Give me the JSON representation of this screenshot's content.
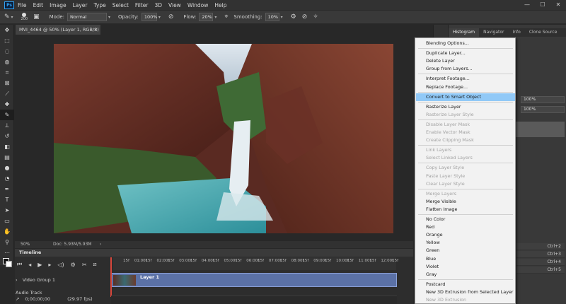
{
  "menubar": {
    "logo": "Ps",
    "items": [
      "File",
      "Edit",
      "Image",
      "Layer",
      "Type",
      "Select",
      "Filter",
      "3D",
      "View",
      "Window",
      "Help"
    ],
    "window_controls": [
      "—",
      "☐",
      "✕"
    ]
  },
  "options": {
    "brush_size": "200",
    "mode_label": "Mode:",
    "mode_value": "Normal",
    "opacity_label": "Opacity:",
    "opacity_value": "100%",
    "flow_label": "Flow:",
    "flow_value": "20%",
    "smoothing_label": "Smoothing:",
    "smoothing_value": "10%"
  },
  "document": {
    "tab_title": "MVI_4464 @ 50% (Layer 1, RGB/8)",
    "zoom": "50%",
    "doc_info": "Doc: 5.93M/5.93M"
  },
  "timeline": {
    "title": "Timeline",
    "ruler": [
      "15f",
      "01:00f",
      "15f",
      "02:00f",
      "15f",
      "03:00f",
      "15f",
      "04:00f",
      "15f",
      "05:00f",
      "15f",
      "06:00f",
      "15f",
      "07:00f",
      "15f",
      "08:00f",
      "15f",
      "09:00f",
      "15f",
      "10:00f",
      "15f",
      "11:00f",
      "15f",
      "12:00f",
      "15f"
    ],
    "video_group": "Video Group 1",
    "audio_track": "Audio Track",
    "timecode": "0;00;00;00",
    "fps": "(29.97 fps)",
    "clip_name": "Layer 1"
  },
  "panels": {
    "tabs": [
      "Histogram",
      "Navigator",
      "Info",
      "Clone Source"
    ],
    "active_tab": "Histogram",
    "values": [
      "100%",
      "100%"
    ],
    "shortcuts": [
      "Ctrl+2",
      "Ctrl+3",
      "Ctrl+4",
      "Ctrl+5"
    ]
  },
  "context_menu": {
    "items": [
      {
        "label": "Blending Options...",
        "enabled": true
      },
      {
        "sep": true
      },
      {
        "label": "Duplicate Layer...",
        "enabled": true
      },
      {
        "label": "Delete Layer",
        "enabled": true
      },
      {
        "label": "Group from Layers...",
        "enabled": true
      },
      {
        "sep": true
      },
      {
        "label": "Interpret Footage...",
        "enabled": true
      },
      {
        "label": "Replace Footage...",
        "enabled": true
      },
      {
        "sep": true
      },
      {
        "label": "Convert to Smart Object",
        "enabled": true,
        "highlighted": true
      },
      {
        "sep": true
      },
      {
        "label": "Rasterize Layer",
        "enabled": true
      },
      {
        "label": "Rasterize Layer Style",
        "enabled": false
      },
      {
        "sep": true
      },
      {
        "label": "Disable Layer Mask",
        "enabled": false
      },
      {
        "label": "Enable Vector Mask",
        "enabled": false
      },
      {
        "label": "Create Clipping Mask",
        "enabled": false
      },
      {
        "sep": true
      },
      {
        "label": "Link Layers",
        "enabled": false
      },
      {
        "label": "Select Linked Layers",
        "enabled": false
      },
      {
        "sep": true
      },
      {
        "label": "Copy Layer Style",
        "enabled": false
      },
      {
        "label": "Paste Layer Style",
        "enabled": false
      },
      {
        "label": "Clear Layer Style",
        "enabled": false
      },
      {
        "sep": true
      },
      {
        "label": "Merge Layers",
        "enabled": false
      },
      {
        "label": "Merge Visible",
        "enabled": true
      },
      {
        "label": "Flatten Image",
        "enabled": true
      },
      {
        "sep": true
      },
      {
        "label": "No Color",
        "enabled": true
      },
      {
        "label": "Red",
        "enabled": true
      },
      {
        "label": "Orange",
        "enabled": true
      },
      {
        "label": "Yellow",
        "enabled": true
      },
      {
        "label": "Green",
        "enabled": true
      },
      {
        "label": "Blue",
        "enabled": true
      },
      {
        "label": "Violet",
        "enabled": true
      },
      {
        "label": "Gray",
        "enabled": true
      },
      {
        "sep": true
      },
      {
        "label": "Postcard",
        "enabled": true
      },
      {
        "label": "New 3D Extrusion from Selected Layer",
        "enabled": true
      },
      {
        "label": "New 3D Extrusion",
        "enabled": false
      }
    ]
  }
}
